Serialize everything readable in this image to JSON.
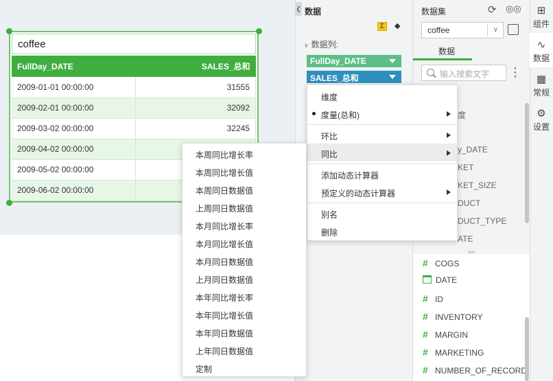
{
  "widget": {
    "title": "coffee",
    "columns": [
      "FullDay_DATE",
      "SALES_总和"
    ],
    "rows": [
      [
        "2009-01-01 00:00:00",
        "31555"
      ],
      [
        "2009-02-01 00:00:00",
        "32092"
      ],
      [
        "2009-03-02 00:00:00",
        "32245"
      ],
      [
        "2009-04-02 00:00:00",
        ""
      ],
      [
        "2009-05-02 00:00:00",
        ""
      ],
      [
        "2009-06-02 00:00:00",
        ""
      ]
    ]
  },
  "data_panel": {
    "title": "数据",
    "columns_label": "数据列:",
    "tags": [
      {
        "label": "FullDay_DATE",
        "color": "#5dbf87"
      },
      {
        "label": "SALES_总和",
        "color": "#2e8fbd"
      }
    ]
  },
  "context_menu": {
    "items": [
      "维度",
      "度量(总和)",
      "环比",
      "同比",
      "添加动态计算器",
      "预定义的动态计算器",
      "别名",
      "删除"
    ],
    "highlighted": "同比"
  },
  "submenu": {
    "items": [
      "本周同比增长率",
      "本周同比增长值",
      "本周同日数据值",
      "上周同日数据值",
      "本月同比增长率",
      "本月同比增长值",
      "本月同日数据值",
      "上月同日数据值",
      "本年同比增长率",
      "本年同比增长值",
      "本年同日数据值",
      "上年同日数据值",
      "定制"
    ]
  },
  "dataset_panel": {
    "title": "数据集",
    "selected_dataset": "coffee",
    "tab": "数据",
    "search_placeholder": "输入搜索文字",
    "partial_fields": [
      "度",
      "y_DATE",
      "KET",
      "KET_SIZE",
      "DUCT",
      "DUCT_TYPE",
      "ATE"
    ],
    "fields": [
      {
        "name": "COGS",
        "type": "measure"
      },
      {
        "name": "DATE",
        "type": "date"
      },
      {
        "name": "ID",
        "type": "measure"
      },
      {
        "name": "INVENTORY",
        "type": "measure"
      },
      {
        "name": "MARGIN",
        "type": "measure"
      },
      {
        "name": "MARKETING",
        "type": "measure"
      },
      {
        "name": "NUMBER_OF_RECORDS",
        "type": "measure"
      }
    ]
  },
  "toolbar": {
    "items": [
      "组件",
      "数据",
      "常规",
      "设置"
    ]
  },
  "colors": {
    "accent": "#3fae3f",
    "tag_date": "#5dbf87",
    "tag_measure": "#2e8fbd"
  }
}
